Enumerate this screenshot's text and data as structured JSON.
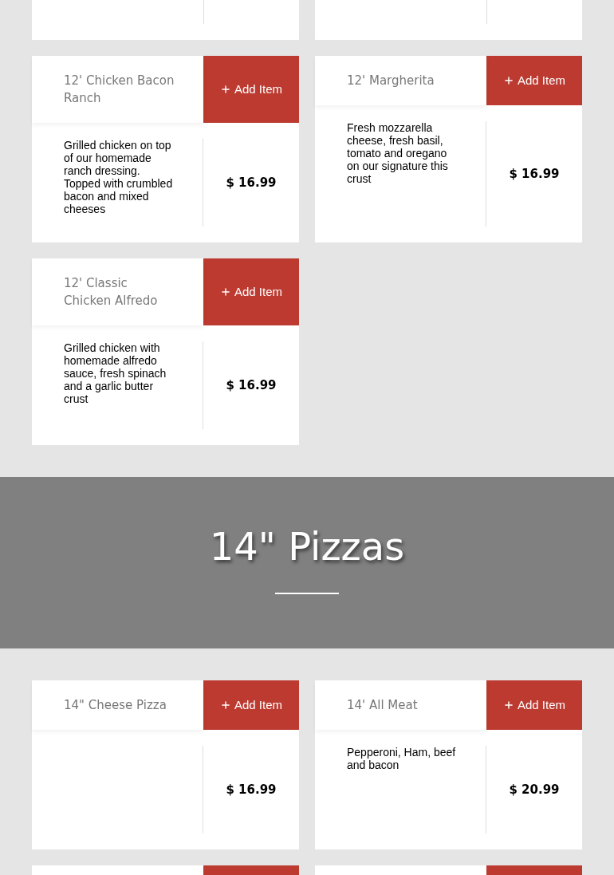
{
  "sections": [
    {
      "items": [
        {
          "name": "12' Chicken Bacon Ranch",
          "button": "Add Item",
          "description": "Grilled chicken on top of our homemade ranch dressing. Topped with crumbled bacon and mixed cheeses",
          "price": "$ 16.99"
        },
        {
          "name": "12' Margherita",
          "button": "Add Item",
          "description": "Fresh mozzarella cheese, fresh basil, tomato and oregano on our signature this crust",
          "price": "$ 16.99"
        },
        {
          "name": "12' Classic Chicken Alfredo",
          "button": "Add Item",
          "description": "Grilled chicken with homemade alfredo sauce, fresh spinach and a garlic butter crust",
          "price": "$ 16.99"
        }
      ]
    },
    {
      "heading": "14\" Pizzas",
      "items": [
        {
          "name": "14\" Cheese Pizza",
          "button": "Add Item",
          "price": "$ 16.99"
        },
        {
          "name": "14' All Meat",
          "button": "Add Item",
          "description": "Pepperoni, Ham, beef and bacon",
          "price": "$ 20.99"
        }
      ]
    }
  ]
}
